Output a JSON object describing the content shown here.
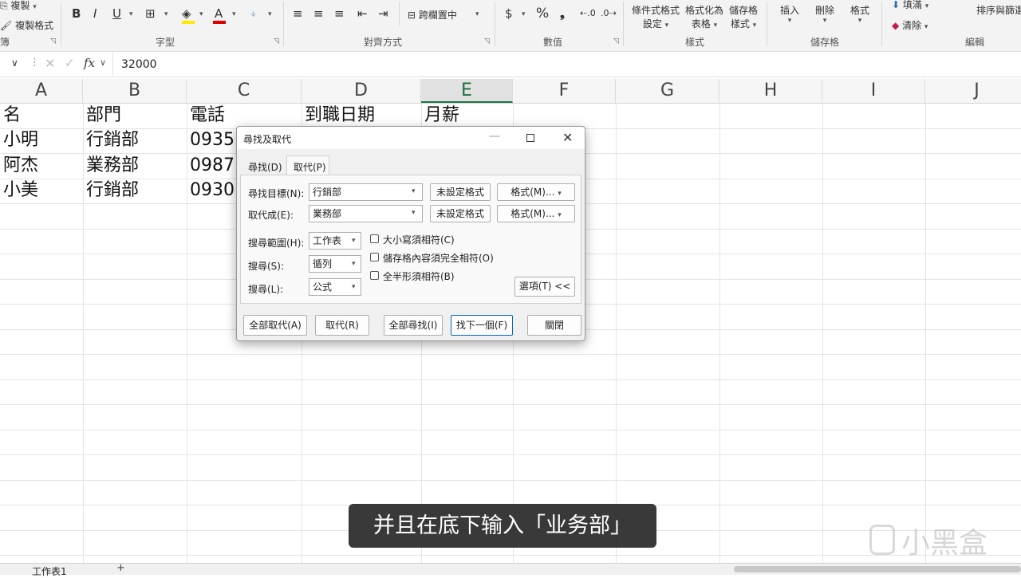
{
  "ribbon": {
    "clipboard": {
      "copy": "複製",
      "format_painter": "複製格式",
      "group_suffix": "簿"
    },
    "font": {
      "group": "字型",
      "bold": "B",
      "italic": "I",
      "underline": "U",
      "font_color_letter": "A"
    },
    "alignment": {
      "group": "對齊方式",
      "merge_center": "跨欄置中"
    },
    "number": {
      "group": "數值",
      "currency": "$",
      "percent": "%",
      "comma": "❟"
    },
    "styles": {
      "group": "樣式",
      "conditional_line1": "條件式格式",
      "conditional_line2": "設定",
      "table_line1": "格式化為",
      "table_line2": "表格",
      "cellstyle_line1": "儲存格",
      "cellstyle_line2": "樣式"
    },
    "cells": {
      "group": "儲存格",
      "insert": "插入",
      "delete": "刪除",
      "format": "格式"
    },
    "editing": {
      "group": "編輯",
      "fill": "填滿",
      "clear": "清除",
      "sort_filter": "排序與篩選"
    }
  },
  "formula_bar": {
    "fx": "fx",
    "value": "32000"
  },
  "columns": [
    "A",
    "B",
    "C",
    "D",
    "E",
    "F",
    "G",
    "H",
    "I",
    "J"
  ],
  "selected_column": "E",
  "cells": {
    "header": [
      "名",
      "部門",
      "電話",
      "到職日期",
      "月薪"
    ],
    "rows": [
      [
        "小明",
        "行銷部",
        "0935"
      ],
      [
        "阿杰",
        "業務部",
        "0987"
      ],
      [
        "小美",
        "行銷部",
        "0930"
      ]
    ]
  },
  "dialog": {
    "title": "尋找及取代",
    "tabs": [
      "尋找(D)",
      "取代(P)"
    ],
    "active_tab": "取代(P)",
    "find_label": "尋找目標(N):",
    "find_value": "行銷部",
    "replace_label": "取代成(E):",
    "replace_value": "業務部",
    "no_format": "未設定格式",
    "format_button": "格式(M)...",
    "within_label": "搜尋範圍(H):",
    "within_value": "工作表",
    "search_label": "搜尋(S):",
    "search_value": "循列",
    "lookin_label": "搜尋(L):",
    "lookin_value": "公式",
    "match_case": "大小寫須相符(C)",
    "match_entire": "儲存格內容須完全相符(O)",
    "match_byte": "全半形須相符(B)",
    "options_button": "選項(T) <<",
    "buttons": [
      "全部取代(A)",
      "取代(R)",
      "全部尋找(I)",
      "找下一個(F)",
      "關閉"
    ]
  },
  "subtitle": "并且在底下输入「业务部」",
  "watermark": "小黑盒",
  "sheet_tab": "工作表1"
}
